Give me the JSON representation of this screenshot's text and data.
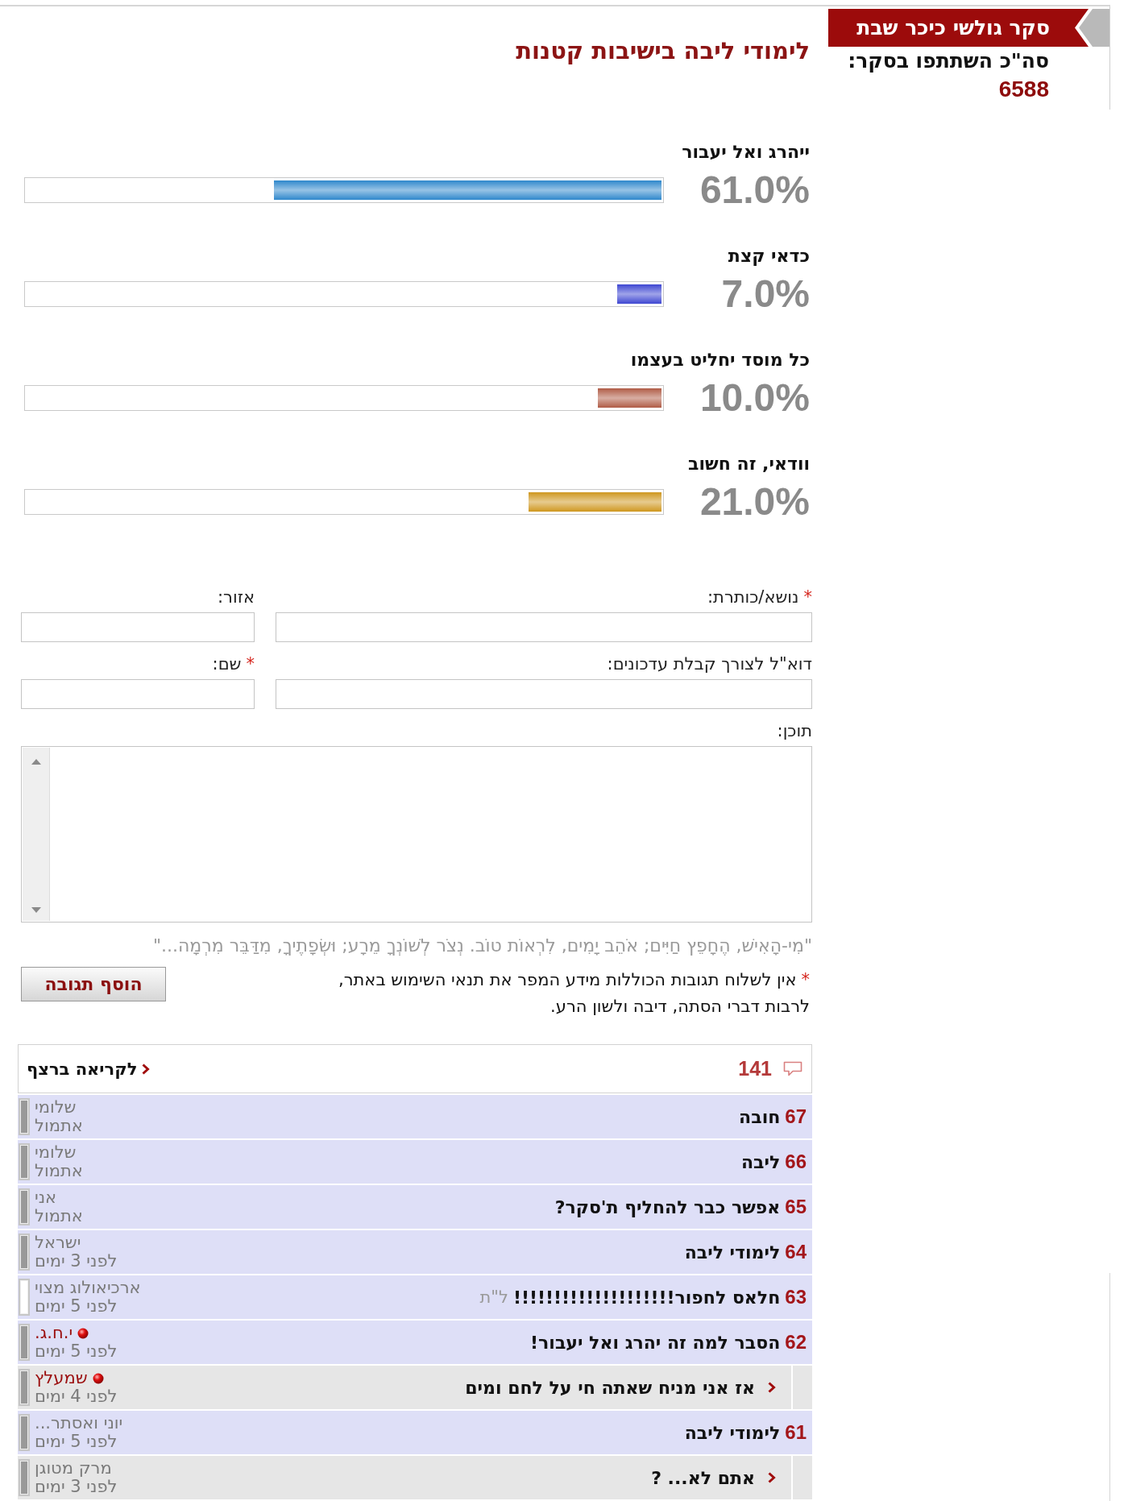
{
  "poll_banner": {
    "title": "סקר גולשי כיכר שבת"
  },
  "participants": {
    "label": "סה\"כ השתתפו בסקר:",
    "count": "6588"
  },
  "poll": {
    "question": "לימודי ליבה בישיבות קטנות",
    "options": [
      {
        "label": "ייהרג ואל יעבור",
        "percent": "61.0%",
        "level": 0.61,
        "color": "#2f88cc"
      },
      {
        "label": "כדאי קצת",
        "percent": "7.0%",
        "level": 0.07,
        "color": "#3f47d2"
      },
      {
        "label": "כל מוסד יחליט בעצמו",
        "percent": "10.0%",
        "level": 0.1,
        "color": "#b05c46"
      },
      {
        "label": "וודאי, זה חשוב",
        "percent": "21.0%",
        "level": 0.21,
        "color": "#cf971f"
      }
    ]
  },
  "comment_form": {
    "fields": [
      {
        "kind": "text",
        "label": "נושא/כותרת:",
        "required_mark": "*"
      },
      {
        "kind": "text",
        "label": "אזור:"
      },
      {
        "kind": "text",
        "label": "דוא\"ל לצורך קבלת עדכונים:"
      },
      {
        "kind": "text",
        "label": "שם:",
        "required_mark": "*"
      },
      {
        "kind": "textarea",
        "label": "תוכן:"
      }
    ],
    "quote": "\"מִי-הָאִישׁ, הֶחָפֵץ חַיִּים; אֹהֵב יָמִים, לִרְאוֹת טוֹב. נְצֹר לְשׁוֹנְךָ מֵרָע; וּשְׂפָתֶיךָ, מִדַּבֵּר מִרְמָה...\"",
    "notice": {
      "mark": "*",
      "text": "אין לשלוח תגובות הכוללות מידע המפר את תנאי השימוש באתר, לרבות דברי הסתה, דיבה ולשון הרע."
    },
    "submit_button": "הוסף תגובה"
  },
  "comments": {
    "count": "141",
    "read_all_link": "לקריאה ברצף",
    "items": [
      {
        "kind": "post",
        "number": "67",
        "title": "חובה",
        "author": "שלומי",
        "time": "אתמול",
        "verified": false,
        "expandable": true
      },
      {
        "kind": "post",
        "number": "66",
        "title": "ליבה",
        "author": "שלומי",
        "time": "אתמול",
        "verified": false,
        "expandable": true
      },
      {
        "kind": "post",
        "number": "65",
        "title": "אפשר כבר להחליף ת'סקר?",
        "author": "אני",
        "time": "אתמול",
        "verified": false,
        "expandable": true
      },
      {
        "kind": "post",
        "number": "64",
        "title": "לימודי ליבה",
        "author": "ישראל",
        "time": "לפני 3 ימים",
        "verified": false,
        "expandable": true
      },
      {
        "kind": "post",
        "number": "63",
        "title": "חלאס לחפור!!!!!!!!!!!!!!!!!!!!",
        "suffix": "ל\"ת",
        "author": "ארכיאולוג מצוי",
        "time": "לפני 5 ימים",
        "verified": false,
        "expandable": false
      },
      {
        "kind": "post",
        "number": "62",
        "title": "הסבר למה זה יהרג ואל יעבור!",
        "author": "י.ח.ג.",
        "time": "לפני 5 ימים",
        "verified": true,
        "expandable": true
      },
      {
        "kind": "reply",
        "title": "אז אני מניח שאתה חי על לחם ומים",
        "author": "שמעלץ",
        "time": "לפני 4 ימים",
        "verified": true,
        "expandable": true
      },
      {
        "kind": "post",
        "number": "61",
        "title": "לימודי ליבה",
        "author": "יוני ואסתר...",
        "time": "לפני 5 ימים",
        "verified": false,
        "expandable": true
      },
      {
        "kind": "reply",
        "title": "אתם לא... ?",
        "author": "מרק מטוגן",
        "time": "לפני 3 ימים",
        "verified": false,
        "expandable": true
      }
    ]
  }
}
